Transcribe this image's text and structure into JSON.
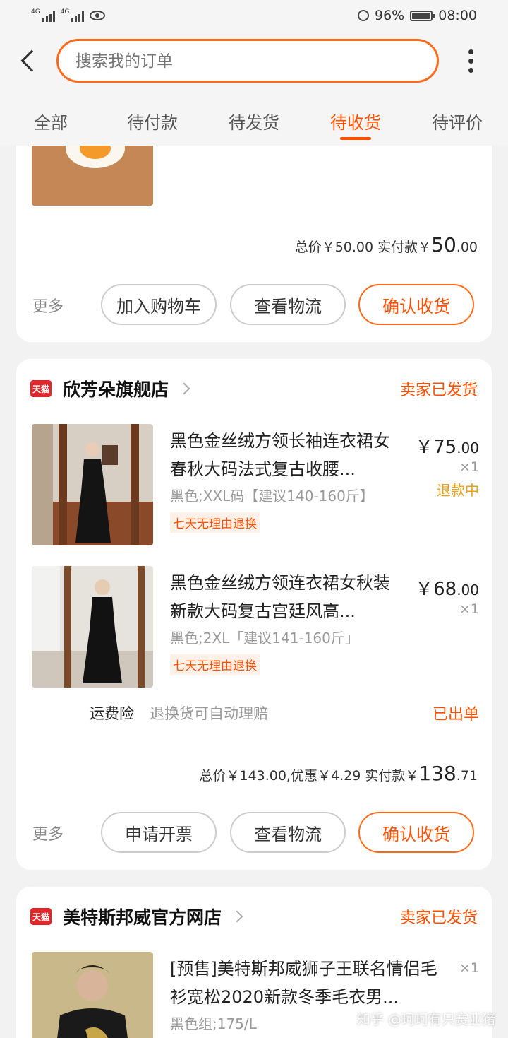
{
  "status_bar": {
    "signal_1": "4G",
    "signal_2": "4G",
    "battery": "96%",
    "time": "08:00",
    "icons": [
      "signal-icon",
      "signal-icon",
      "eye-icon",
      "alarm-icon",
      "battery-icon"
    ]
  },
  "header": {
    "search_placeholder": "搜索我的订单",
    "icons": [
      "back-arrow-icon",
      "more-vertical-icon"
    ]
  },
  "tabs": [
    {
      "label": "全部",
      "active": false
    },
    {
      "label": "待付款",
      "active": false
    },
    {
      "label": "待发货",
      "active": false
    },
    {
      "label": "待收货",
      "active": true
    },
    {
      "label": "待评价",
      "active": false
    }
  ],
  "accent_color": "#ff5000",
  "order1": {
    "total_label": "总价￥50.00 实付款￥",
    "paid_int": "50",
    "paid_dec": ".00",
    "more": "更多",
    "btn1": "加入购物车",
    "btn2": "查看物流",
    "btn3": "确认收货"
  },
  "order2": {
    "shop_badge": "天猫",
    "shop_name": "欣芳朵旗舰店",
    "status": "卖家已发货",
    "items": [
      {
        "title": "黑色金丝绒方领长袖连衣裙女春秋大码法式复古收腰...",
        "sku": "黑色;XXL码【建议140-160斤】",
        "tag": "七天无理由退换",
        "price_int": "￥75",
        "price_dec": ".00",
        "qty": "×1",
        "refund": "退款中"
      },
      {
        "title": "黑色金丝绒方领连衣裙女秋装新款大码复古宫廷风高...",
        "sku": "黑色;2XL「建议141-160斤」",
        "tag": "七天无理由退换",
        "price_int": "￥68",
        "price_dec": ".00",
        "qty": "×1"
      }
    ],
    "insurance_label": "运费险",
    "insurance_desc": "退换货可自动理赔",
    "insurance_status": "已出单",
    "total_label": "总价￥143.00,优惠￥4.29 实付款￥",
    "paid_int": "138",
    "paid_dec": ".71",
    "more": "更多",
    "btn1": "申请开票",
    "btn2": "查看物流",
    "btn3": "确认收货"
  },
  "order3": {
    "shop_badge": "天猫",
    "shop_name": "美特斯邦威官方网店",
    "status": "卖家已发货",
    "items": [
      {
        "title": "[预售]美特斯邦威狮子王联名情侣毛衫宽松2020新款冬季毛衣男...",
        "sku": "黑色组;175/L",
        "qty": "×1"
      }
    ]
  },
  "watermark": "知乎 @珂珂有只赛亚猪"
}
